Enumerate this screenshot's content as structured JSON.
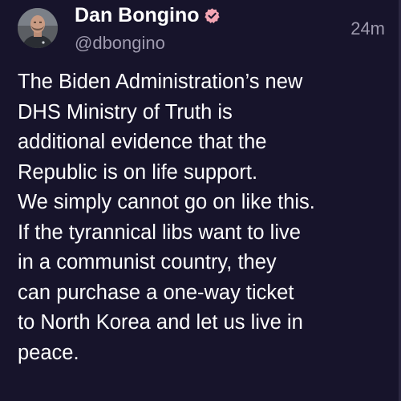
{
  "author": {
    "display_name": "Dan Bongino",
    "handle": "@dbongino",
    "verified": true,
    "avatar_icon": "profile-photo"
  },
  "post": {
    "timestamp": "24m",
    "lines": [
      "The Biden Administration’s new",
      "DHS Ministry of Truth is",
      "additional evidence that the",
      "Republic is on life support.",
      "We simply cannot go on like this.",
      "If the tyrannical libs want to live",
      "in a communist country, they",
      "can purchase a one-way ticket",
      "to North Korea and let us live in",
      "peace."
    ]
  },
  "colors": {
    "background": "#17142b",
    "text": "#ffffff",
    "secondary_text": "#9e9aae",
    "verified_badge": "#f2a5b3"
  }
}
